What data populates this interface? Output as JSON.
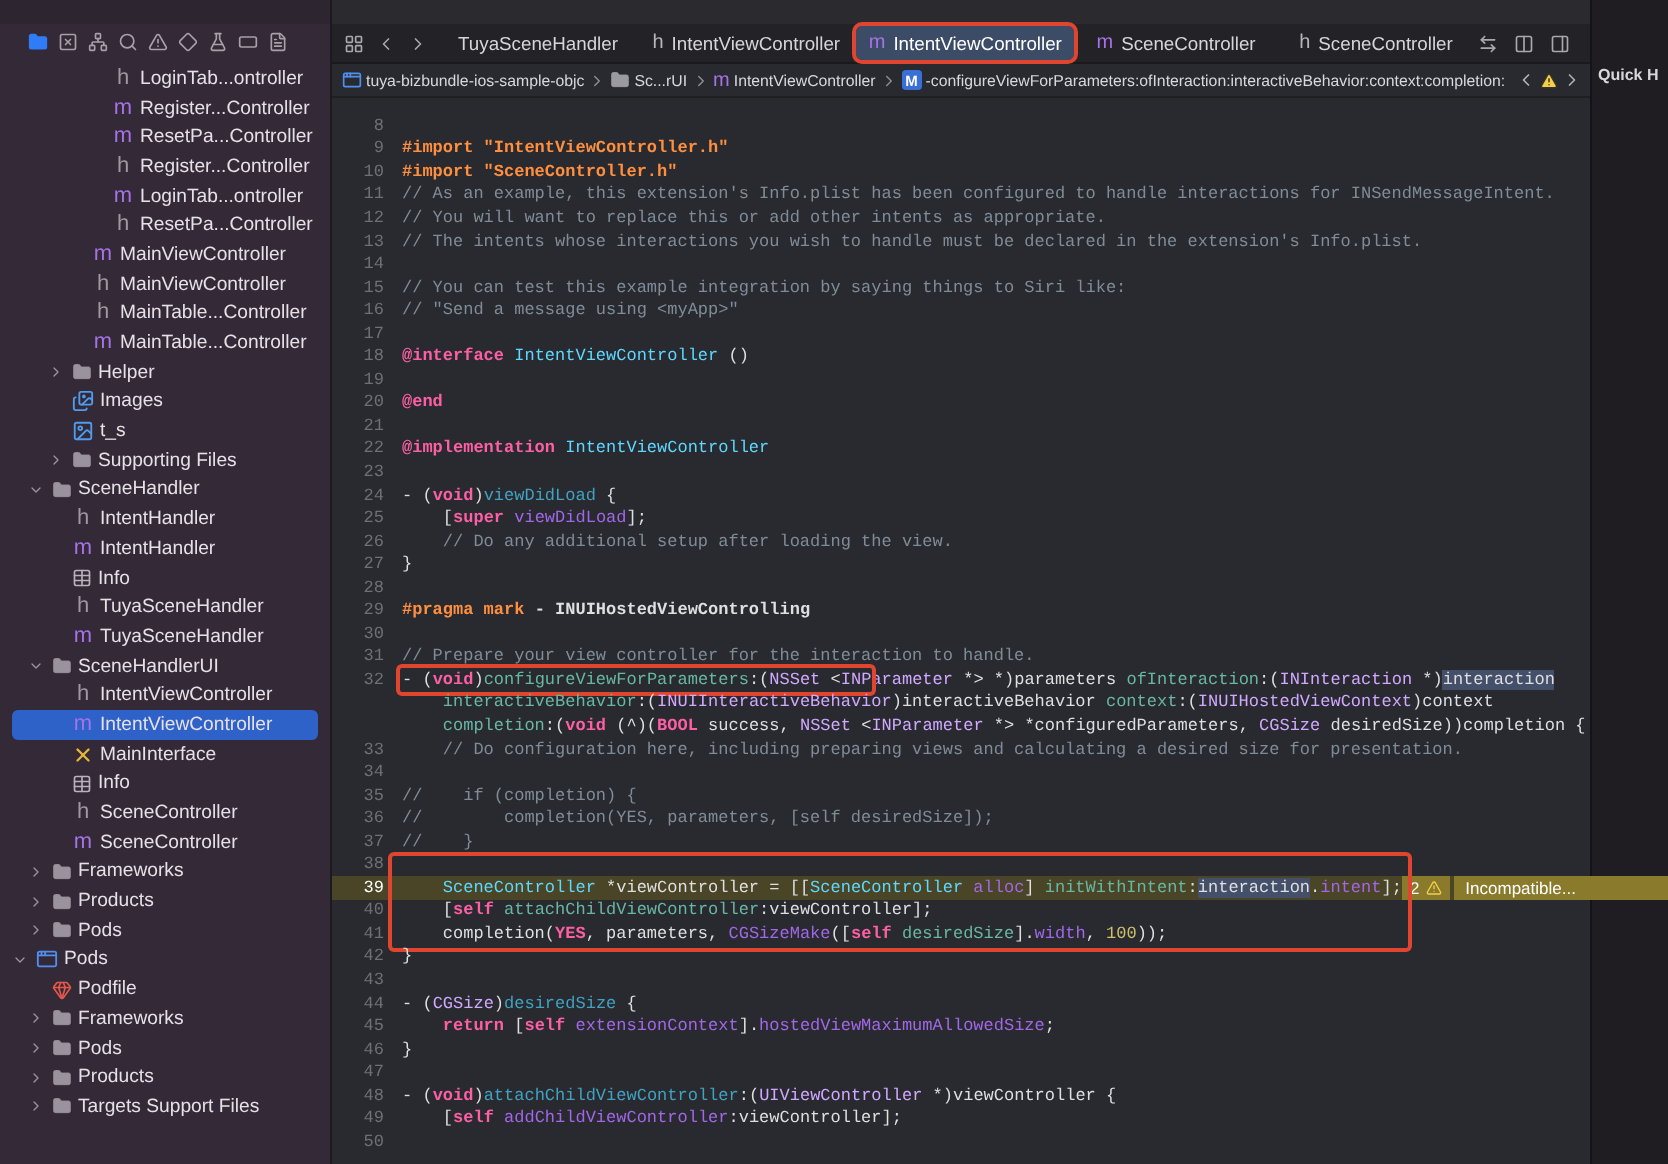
{
  "navigator": {
    "tools": [
      {
        "kind": "folder",
        "selected": true
      },
      {
        "kind": "xsquare",
        "selected": false
      },
      {
        "kind": "hierarchy",
        "selected": false
      },
      {
        "kind": "search",
        "selected": false
      },
      {
        "kind": "warning",
        "selected": false
      },
      {
        "kind": "diamond",
        "selected": false
      },
      {
        "kind": "flask",
        "selected": false
      },
      {
        "kind": "tag",
        "selected": false
      },
      {
        "kind": "doc",
        "selected": false
      }
    ],
    "tree": [
      {
        "children": [
          {
            "children": [
              {
                "children": [
                  {
                    "children": [
                      {
                        "label": "LoginTab...ontroller",
                        "kind": "header",
                        "glyph": "h",
                        "selected": false
                      },
                      {
                        "label": "Register...Controller",
                        "kind": "source",
                        "glyph": "m",
                        "selected": false
                      },
                      {
                        "label": "ResetPa...Controller",
                        "kind": "source",
                        "glyph": "m",
                        "selected": false
                      },
                      {
                        "label": "Register...Controller",
                        "kind": "header",
                        "glyph": "h",
                        "selected": false
                      },
                      {
                        "label": "LoginTab...ontroller",
                        "kind": "source",
                        "glyph": "m",
                        "selected": false
                      },
                      {
                        "label": "ResetPa...Controller",
                        "kind": "header",
                        "glyph": "h",
                        "selected": false
                      }
                    ]
                  },
                  {
                    "label": "MainViewController",
                    "kind": "source",
                    "glyph": "m",
                    "selected": false
                  },
                  {
                    "label": "MainViewController",
                    "kind": "header",
                    "glyph": "h",
                    "selected": false
                  },
                  {
                    "label": "MainTable...Controller",
                    "kind": "header",
                    "glyph": "h",
                    "selected": false
                  },
                  {
                    "label": "MainTable...Controller",
                    "kind": "source",
                    "glyph": "m",
                    "selected": false
                  }
                ]
              },
              {
                "label": "Helper",
                "kind": "folder",
                "expanded": false,
                "selected": false
              },
              {
                "label": "Images",
                "kind": "assets",
                "selected": false
              },
              {
                "label": "t_s",
                "kind": "image",
                "selected": false
              },
              {
                "label": "Supporting Files",
                "kind": "folder",
                "expanded": false,
                "selected": false
              }
            ]
          },
          {
            "label": "SceneHandler",
            "kind": "folder",
            "expanded": true,
            "selected": false,
            "children": [
              {
                "label": "IntentHandler",
                "kind": "header",
                "glyph": "h",
                "selected": false
              },
              {
                "label": "IntentHandler",
                "kind": "source",
                "glyph": "m",
                "selected": false
              },
              {
                "label": "Info",
                "kind": "plist",
                "selected": false
              },
              {
                "label": "TuyaSceneHandler",
                "kind": "header",
                "glyph": "h",
                "selected": false
              },
              {
                "label": "TuyaSceneHandler",
                "kind": "source",
                "glyph": "m",
                "selected": false
              }
            ]
          },
          {
            "label": "SceneHandlerUI",
            "kind": "folder",
            "expanded": true,
            "selected": false,
            "children": [
              {
                "label": "IntentViewController",
                "kind": "header",
                "glyph": "h",
                "selected": false
              },
              {
                "label": "IntentViewController",
                "kind": "source",
                "glyph": "m",
                "selected": true
              },
              {
                "label": "MainInterface",
                "kind": "storyboard",
                "selected": false
              },
              {
                "label": "Info",
                "kind": "plist",
                "selected": false
              },
              {
                "label": "SceneController",
                "kind": "header",
                "glyph": "h",
                "selected": false
              },
              {
                "label": "SceneController",
                "kind": "source",
                "glyph": "m",
                "selected": false
              }
            ]
          },
          {
            "label": "Frameworks",
            "kind": "folder",
            "expanded": false,
            "selected": false
          },
          {
            "label": "Products",
            "kind": "folder",
            "expanded": false,
            "selected": false
          },
          {
            "label": "Pods",
            "kind": "folder",
            "expanded": false,
            "selected": false
          }
        ]
      },
      {
        "label": "Pods",
        "kind": "project",
        "expanded": true,
        "selected": false,
        "children": [
          {
            "label": "Podfile",
            "kind": "podfile",
            "selected": false
          },
          {
            "label": "Frameworks",
            "kind": "folder",
            "expanded": false,
            "selected": false
          },
          {
            "label": "Pods",
            "kind": "folder",
            "expanded": false,
            "selected": false
          },
          {
            "label": "Products",
            "kind": "folder",
            "expanded": false,
            "selected": false
          },
          {
            "label": "Targets Support Files",
            "kind": "folder",
            "expanded": false,
            "selected": false
          }
        ]
      }
    ]
  },
  "tabs": [
    {
      "label": "TuyaSceneHandler",
      "selected": false,
      "flagged": false
    },
    {
      "label": "IntentViewController",
      "kind": "header",
      "glyph": "h",
      "selected": false,
      "flagged": false
    },
    {
      "label": "IntentViewController",
      "kind": "source",
      "glyph": "m",
      "selected": true,
      "flagged": true
    },
    {
      "label": "SceneController",
      "kind": "source",
      "glyph": "m",
      "selected": false,
      "flagged": false
    },
    {
      "label": "SceneController",
      "kind": "header",
      "glyph": "h",
      "selected": false,
      "flagged": false
    }
  ],
  "breadcrumb": [
    {
      "label": "tuya-bizbundle-ios-sample-objc",
      "kind": "project"
    },
    {
      "label": "Sc...rUI",
      "kind": "folder"
    },
    {
      "label": "IntentViewController",
      "kind": "source",
      "glyph": "m"
    },
    {
      "label": "-configureViewForParameters:ofInteraction:interactiveBehavior:context:completion:",
      "kind": "method",
      "glyph": "M"
    }
  ],
  "inspector": {
    "title": "Quick H"
  },
  "code": [
    {
      "number": "8"
    },
    {
      "number": "9",
      "segments": [
        {
          "kind": "pre",
          "text": "#import \"IntentViewController.h\""
        }
      ]
    },
    {
      "number": "10",
      "segments": [
        {
          "kind": "pre",
          "text": "#import \"SceneController.h\""
        }
      ]
    },
    {
      "number": "11",
      "segments": [
        {
          "kind": "com",
          "text": "// As an example, this extension's Info.plist has been configured to handle interactions for INSendMessageIntent."
        }
      ]
    },
    {
      "number": "12",
      "segments": [
        {
          "kind": "com",
          "text": "// You will want to replace this or add other intents as appropriate."
        }
      ]
    },
    {
      "number": "13",
      "segments": [
        {
          "kind": "com",
          "text": "// The intents whose interactions you wish to handle must be declared in the extension's Info.plist."
        }
      ]
    },
    {
      "number": "14"
    },
    {
      "number": "15",
      "segments": [
        {
          "kind": "com",
          "text": "// You can test this example integration by saying things to Siri like:"
        }
      ]
    },
    {
      "number": "16",
      "segments": [
        {
          "kind": "com",
          "text": "// \"Send a message using <myApp>\""
        }
      ]
    },
    {
      "number": "17"
    },
    {
      "number": "18",
      "segments": [
        {
          "kind": "kw",
          "text": "@interface"
        },
        {
          "kind": "cls",
          "text": " IntentViewController"
        },
        {
          "kind": "pl",
          "text": " ()"
        }
      ]
    },
    {
      "number": "19"
    },
    {
      "number": "20",
      "segments": [
        {
          "kind": "kw",
          "text": "@end"
        }
      ]
    },
    {
      "number": "21"
    },
    {
      "number": "22",
      "segments": [
        {
          "kind": "kw",
          "text": "@implementation"
        },
        {
          "kind": "cls",
          "text": " IntentViewController"
        }
      ]
    },
    {
      "number": "23"
    },
    {
      "number": "24",
      "segments": [
        {
          "kind": "pl",
          "text": "- ("
        },
        {
          "kind": "kw",
          "text": "void"
        },
        {
          "kind": "pl",
          "text": ")"
        },
        {
          "kind": "dec",
          "text": "viewDidLoad"
        },
        {
          "kind": "pl",
          "text": " {"
        }
      ]
    },
    {
      "number": "25",
      "segments": [
        {
          "kind": "pl",
          "text": "    ["
        },
        {
          "kind": "kw",
          "text": "super"
        },
        {
          "kind": "sys",
          "text": " viewDidLoad"
        },
        {
          "kind": "pl",
          "text": "];"
        }
      ]
    },
    {
      "number": "26",
      "segments": [
        {
          "kind": "com",
          "text": "    // Do any additional setup after loading the view."
        }
      ]
    },
    {
      "number": "27",
      "segments": [
        {
          "kind": "pl",
          "text": "}"
        }
      ]
    },
    {
      "number": "28"
    },
    {
      "number": "29",
      "segments": [
        {
          "kind": "pre",
          "text": "#pragma mark"
        },
        {
          "kind": "bold",
          "text": " - INUIHostedViewControlling"
        }
      ]
    },
    {
      "number": "30"
    },
    {
      "number": "31",
      "segments": [
        {
          "kind": "com",
          "text": "// Prepare your view controller for the interaction to handle."
        }
      ]
    },
    {
      "number": "32",
      "boxed_chars": true,
      "segments": [
        {
          "kind": "pl",
          "text": "- ("
        },
        {
          "kind": "kw",
          "text": "void"
        },
        {
          "kind": "pl",
          "text": ")"
        },
        {
          "kind": "fn",
          "text": "configureViewForParameters"
        },
        {
          "kind": "pl",
          "text": ":("
        },
        {
          "kind": "typ",
          "text": "NSSet"
        },
        {
          "kind": "pl",
          "text": " <"
        },
        {
          "kind": "typ",
          "text": "IN"
        }
      ],
      "rest": [
        {
          "kind": "typ",
          "text": "Parameter"
        },
        {
          "kind": "pl",
          "text": " *> *)parameters "
        },
        {
          "kind": "fn",
          "text": "ofInteraction"
        },
        {
          "kind": "pl",
          "text": ":("
        },
        {
          "kind": "typ",
          "text": "INInteraction"
        },
        {
          "kind": "pl",
          "text": " *)"
        },
        {
          "kind": "hl",
          "text": "interaction"
        }
      ]
    },
    {
      "segments": [
        {
          "kind": "fn",
          "text": "    interactiveBehavior"
        },
        {
          "kind": "pl",
          "text": ":("
        },
        {
          "kind": "typ",
          "text": "INUIInteractiveBehavior"
        },
        {
          "kind": "pl",
          "text": ")interactiveBehavior "
        },
        {
          "kind": "fn",
          "text": "context"
        },
        {
          "kind": "pl",
          "text": ":("
        },
        {
          "kind": "typ",
          "text": "INUIHostedViewContext"
        },
        {
          "kind": "pl",
          "text": ")context"
        }
      ]
    },
    {
      "segments": [
        {
          "kind": "fn",
          "text": "    completion"
        },
        {
          "kind": "pl",
          "text": ":("
        },
        {
          "kind": "kw",
          "text": "void"
        },
        {
          "kind": "pl",
          "text": " (^)("
        },
        {
          "kind": "kw",
          "text": "BOOL"
        },
        {
          "kind": "pl",
          "text": " success, "
        },
        {
          "kind": "typ",
          "text": "NSSet"
        },
        {
          "kind": "pl",
          "text": " <"
        },
        {
          "kind": "typ",
          "text": "INParameter"
        },
        {
          "kind": "pl",
          "text": " *> *configuredParameters, "
        },
        {
          "kind": "typ",
          "text": "CGSize"
        },
        {
          "kind": "pl",
          "text": " desiredSize))completion {"
        }
      ]
    },
    {
      "number": "33",
      "segments": [
        {
          "kind": "com",
          "text": "    // Do configuration here, including preparing views and calculating a desired size for presentation."
        }
      ]
    },
    {
      "number": "34"
    },
    {
      "number": "35",
      "segments": [
        {
          "kind": "com",
          "text": "//    if (completion) {"
        }
      ]
    },
    {
      "number": "36",
      "segments": [
        {
          "kind": "com",
          "text": "//        completion(YES, parameters, [self desiredSize]);"
        }
      ]
    },
    {
      "number": "37",
      "segments": [
        {
          "kind": "com",
          "text": "//    }"
        }
      ]
    },
    {
      "number": "38",
      "boxed": true
    },
    {
      "number": "39",
      "boxed": true,
      "current": true,
      "segments": [
        {
          "kind": "cls",
          "text": "    SceneController"
        },
        {
          "kind": "pl",
          "text": " *viewController = [["
        },
        {
          "kind": "cls",
          "text": "SceneController"
        },
        {
          "kind": "sys",
          "text": " alloc"
        },
        {
          "kind": "pl",
          "text": "] "
        },
        {
          "kind": "fn",
          "text": "initWithIntent"
        },
        {
          "kind": "pl",
          "text": ":"
        },
        {
          "kind": "hl",
          "text": "interaction"
        },
        {
          "kind": "pl",
          "text": "."
        },
        {
          "kind": "sys",
          "text": "intent"
        },
        {
          "kind": "pl",
          "text": "];"
        }
      ],
      "issue": {
        "count": "2",
        "message": "Incompatible..."
      }
    },
    {
      "number": "40",
      "boxed": true,
      "segments": [
        {
          "kind": "pl",
          "text": "    ["
        },
        {
          "kind": "kw",
          "text": "self"
        },
        {
          "kind": "fn",
          "text": " attachChildViewController"
        },
        {
          "kind": "pl",
          "text": ":viewController];"
        }
      ]
    },
    {
      "number": "41",
      "boxed": true,
      "segments": [
        {
          "kind": "pl",
          "text": "    completion("
        },
        {
          "kind": "kw",
          "text": "YES"
        },
        {
          "kind": "pl",
          "text": ", parameters, "
        },
        {
          "kind": "sys",
          "text": "CGSizeMake"
        },
        {
          "kind": "pl",
          "text": "(["
        },
        {
          "kind": "kw",
          "text": "self"
        },
        {
          "kind": "fn",
          "text": " desiredSize"
        },
        {
          "kind": "pl",
          "text": "]."
        },
        {
          "kind": "sys",
          "text": "width"
        },
        {
          "kind": "pl",
          "text": ", "
        },
        {
          "kind": "num",
          "text": "100"
        },
        {
          "kind": "pl",
          "text": "));"
        }
      ]
    },
    {
      "number": "42",
      "segments": [
        {
          "kind": "pl",
          "text": "}"
        }
      ]
    },
    {
      "number": "43"
    },
    {
      "number": "44",
      "segments": [
        {
          "kind": "pl",
          "text": "- ("
        },
        {
          "kind": "typ",
          "text": "CGSize"
        },
        {
          "kind": "pl",
          "text": ")"
        },
        {
          "kind": "dec",
          "text": "desiredSize"
        },
        {
          "kind": "pl",
          "text": " {"
        }
      ]
    },
    {
      "number": "45",
      "segments": [
        {
          "kind": "kw",
          "text": "    return"
        },
        {
          "kind": "pl",
          "text": " ["
        },
        {
          "kind": "kw",
          "text": "self"
        },
        {
          "kind": "sys",
          "text": " extensionContext"
        },
        {
          "kind": "pl",
          "text": "]."
        },
        {
          "kind": "sys",
          "text": "hostedViewMaximumAllowedSize"
        },
        {
          "kind": "pl",
          "text": ";"
        }
      ]
    },
    {
      "number": "46",
      "segments": [
        {
          "kind": "pl",
          "text": "}"
        }
      ]
    },
    {
      "number": "47"
    },
    {
      "number": "48",
      "segments": [
        {
          "kind": "pl",
          "text": "- ("
        },
        {
          "kind": "kw",
          "text": "void"
        },
        {
          "kind": "pl",
          "text": ")"
        },
        {
          "kind": "dec",
          "text": "attachChildViewController"
        },
        {
          "kind": "pl",
          "text": ":("
        },
        {
          "kind": "typ",
          "text": "UIViewController"
        },
        {
          "kind": "pl",
          "text": " *)viewController {"
        }
      ]
    },
    {
      "number": "49",
      "segments": [
        {
          "kind": "pl",
          "text": "    ["
        },
        {
          "kind": "kw",
          "text": "self"
        },
        {
          "kind": "sys",
          "text": " addChildViewController"
        },
        {
          "kind": "pl",
          "text": ":viewController];"
        }
      ]
    },
    {
      "number": "50"
    }
  ]
}
